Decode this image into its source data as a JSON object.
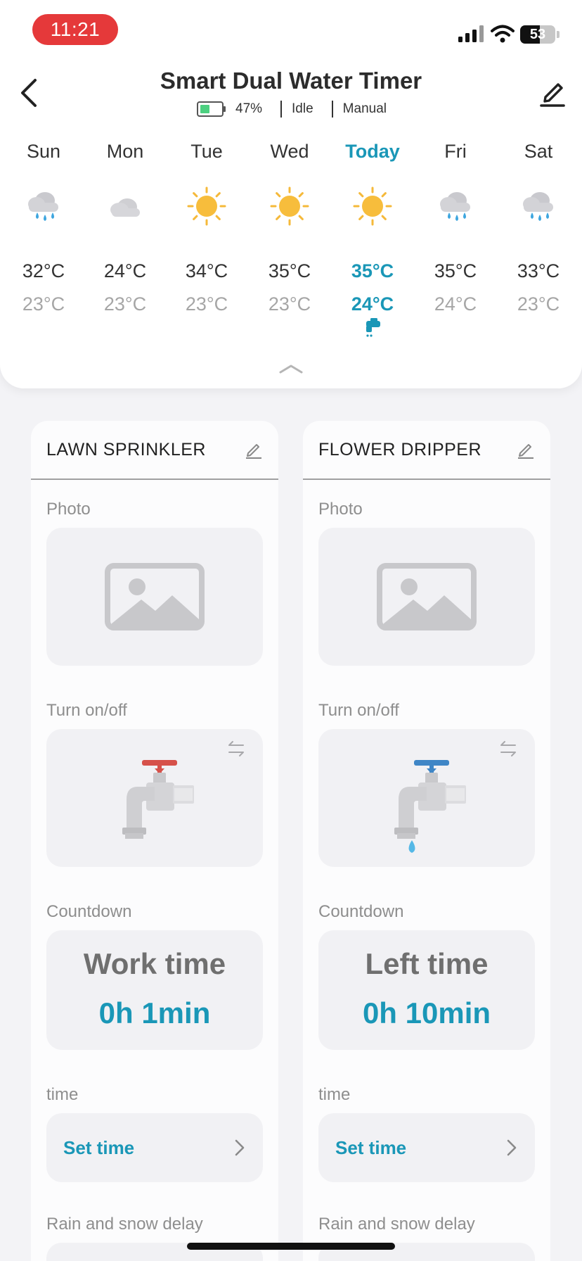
{
  "status_bar": {
    "time": "11:21",
    "battery_level": "53"
  },
  "header": {
    "title": "Smart Dual Water Timer",
    "battery": "47%",
    "state": "Idle",
    "mode": "Manual"
  },
  "weather": [
    {
      "day": "Sun",
      "icon": "rain-cloud-icon",
      "high": "32°C",
      "low": "23°C"
    },
    {
      "day": "Mon",
      "icon": "cloud-icon",
      "high": "24°C",
      "low": "23°C"
    },
    {
      "day": "Tue",
      "icon": "sun-icon",
      "high": "34°C",
      "low": "23°C"
    },
    {
      "day": "Wed",
      "icon": "sun-icon",
      "high": "35°C",
      "low": "23°C"
    },
    {
      "day": "Today",
      "icon": "sun-icon",
      "high": "35°C",
      "low": "24°C",
      "watering_icon": "tap-icon"
    },
    {
      "day": "Fri",
      "icon": "rain-cloud-icon",
      "high": "35°C",
      "low": "24°C"
    },
    {
      "day": "Sat",
      "icon": "rain-cloud-icon",
      "high": "33°C",
      "low": "23°C"
    }
  ],
  "colors": {
    "accent": "#1a97b7",
    "time_pill": "#e5393a",
    "valve_off": "#d6514a",
    "valve_on": "#3f86c6",
    "water": "#55b8e6"
  },
  "zones": [
    {
      "name": "LAWN SPRINKLER",
      "photo_label": "Photo",
      "toggle_label": "Turn on/off",
      "valve_state": "off",
      "countdown_label": "Countdown",
      "countdown_title": "Work time",
      "countdown_value": "0h 1min",
      "time_label": "time",
      "set_time": "Set time",
      "delay_label": "Rain and snow delay"
    },
    {
      "name": "FLOWER DRIPPER",
      "photo_label": "Photo",
      "toggle_label": "Turn on/off",
      "valve_state": "on",
      "countdown_label": "Countdown",
      "countdown_title": "Left time",
      "countdown_value": "0h 10min",
      "time_label": "time",
      "set_time": "Set time",
      "delay_label": "Rain and snow delay"
    }
  ]
}
